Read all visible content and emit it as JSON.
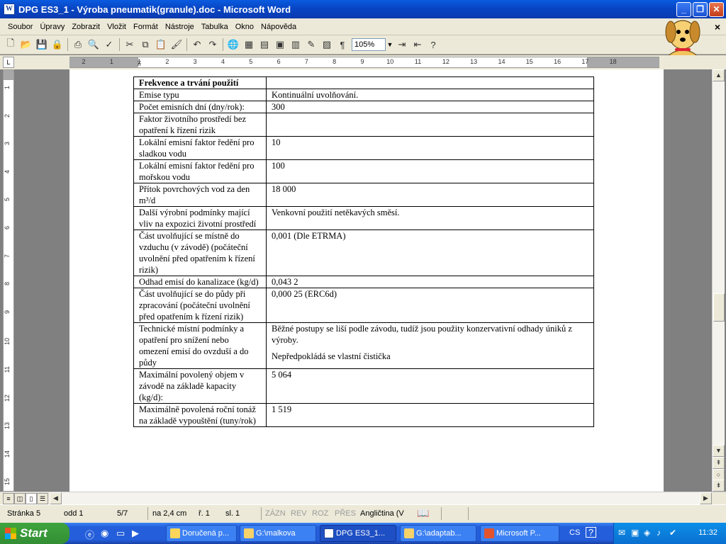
{
  "window": {
    "title": "DPG ES3_1 - Výroba pneumatik(granule).doc - Microsoft Word",
    "icon": "word-document-icon",
    "controls": [
      "minimize-icon",
      "restore-icon",
      "close-icon"
    ]
  },
  "menu": {
    "items": [
      "Soubor",
      "Úpravy",
      "Zobrazit",
      "Vložit",
      "Formát",
      "Nástroje",
      "Tabulka",
      "Okno",
      "Nápověda"
    ],
    "close_glyph": "×"
  },
  "toolbar": {
    "zoom": "105%"
  },
  "ruler": {
    "h_ticks": [
      "2",
      "1",
      "1",
      "2",
      "3",
      "4",
      "5",
      "6",
      "7",
      "8",
      "9",
      "10",
      "11",
      "12",
      "13",
      "14",
      "15",
      "16",
      "17",
      "18"
    ],
    "v_ticks": [
      "1",
      "2",
      "3",
      "4",
      "5",
      "6",
      "7",
      "8",
      "9",
      "10",
      "11",
      "12",
      "13",
      "14",
      "15"
    ],
    "corner": "L"
  },
  "table": {
    "header": "Frekvence a trvání použití",
    "rows": [
      {
        "label": "Emise typu",
        "value": [
          "Kontinuální uvolňování."
        ]
      },
      {
        "label": "Počet emisních dní (dny/rok):",
        "value": [
          "300"
        ]
      },
      {
        "label": "Faktor životního prostředí bez opatření k řízení rizik",
        "value": [
          ""
        ]
      },
      {
        "label": "Lokální emisní faktor ředění pro sladkou vodu",
        "value": [
          "10"
        ]
      },
      {
        "label": "Lokální emisní faktor ředění pro mořskou vodu",
        "value": [
          "100"
        ]
      },
      {
        "label": "Přítok povrchových vod za den m³/d",
        "value": [
          "18 000"
        ]
      },
      {
        "label": "Další výrobní podmínky mající vliv na expozici životní prostředí",
        "value": [
          "Venkovní použití netěkavých směsí."
        ]
      },
      {
        "label": "Část uvolňující se místně do vzduchu (v závodě) (počáteční uvolnění před opatřením k řízení rizik)",
        "value": [
          "0,001 (Dle ETRMA)"
        ]
      },
      {
        "label": "Odhad emisí do kanalizace (kg/d)",
        "value": [
          "0,043 2"
        ]
      },
      {
        "label": "Část uvolňující se do půdy při zpracování (počáteční uvolnění před opatřením k řízení rizik)",
        "value": [
          "0,000 25 (ERC6d)"
        ]
      },
      {
        "label": "Technické místní podmínky a opatření pro snížení nebo omezení emisí do ovzduší a do půdy",
        "value": [
          "Běžné postupy se liší podle závodu, tudíž jsou použity konzervativní odhady úniků z výroby.",
          "Nepředpokládá se vlastní čistička"
        ]
      },
      {
        "label": "Maximální povolený objem v závodě na základě kapacity (kg/d):",
        "value": [
          "5 064"
        ]
      },
      {
        "label": "Maximálně povolená roční tonáž na základě vypouštění (tuny/rok)",
        "value": [
          "1 519"
        ]
      }
    ]
  },
  "status": {
    "page": "Stránka 5",
    "section": "odd 1",
    "pages": "5/7",
    "at": "na 2,4 cm",
    "line": "ř. 1",
    "col": "sl. 1",
    "modes": [
      "ZÁZN",
      "REV",
      "ROZ",
      "PŘES"
    ],
    "language": "Angličtina (V"
  },
  "taskbar": {
    "start": "Start",
    "tasks": [
      "Doručená p...",
      "G:\\malkova",
      "DPG ES3_1...",
      "G:\\adaptab...",
      "Microsoft P..."
    ],
    "active_task": 2,
    "lang": "CS",
    "clock": "11:32"
  }
}
